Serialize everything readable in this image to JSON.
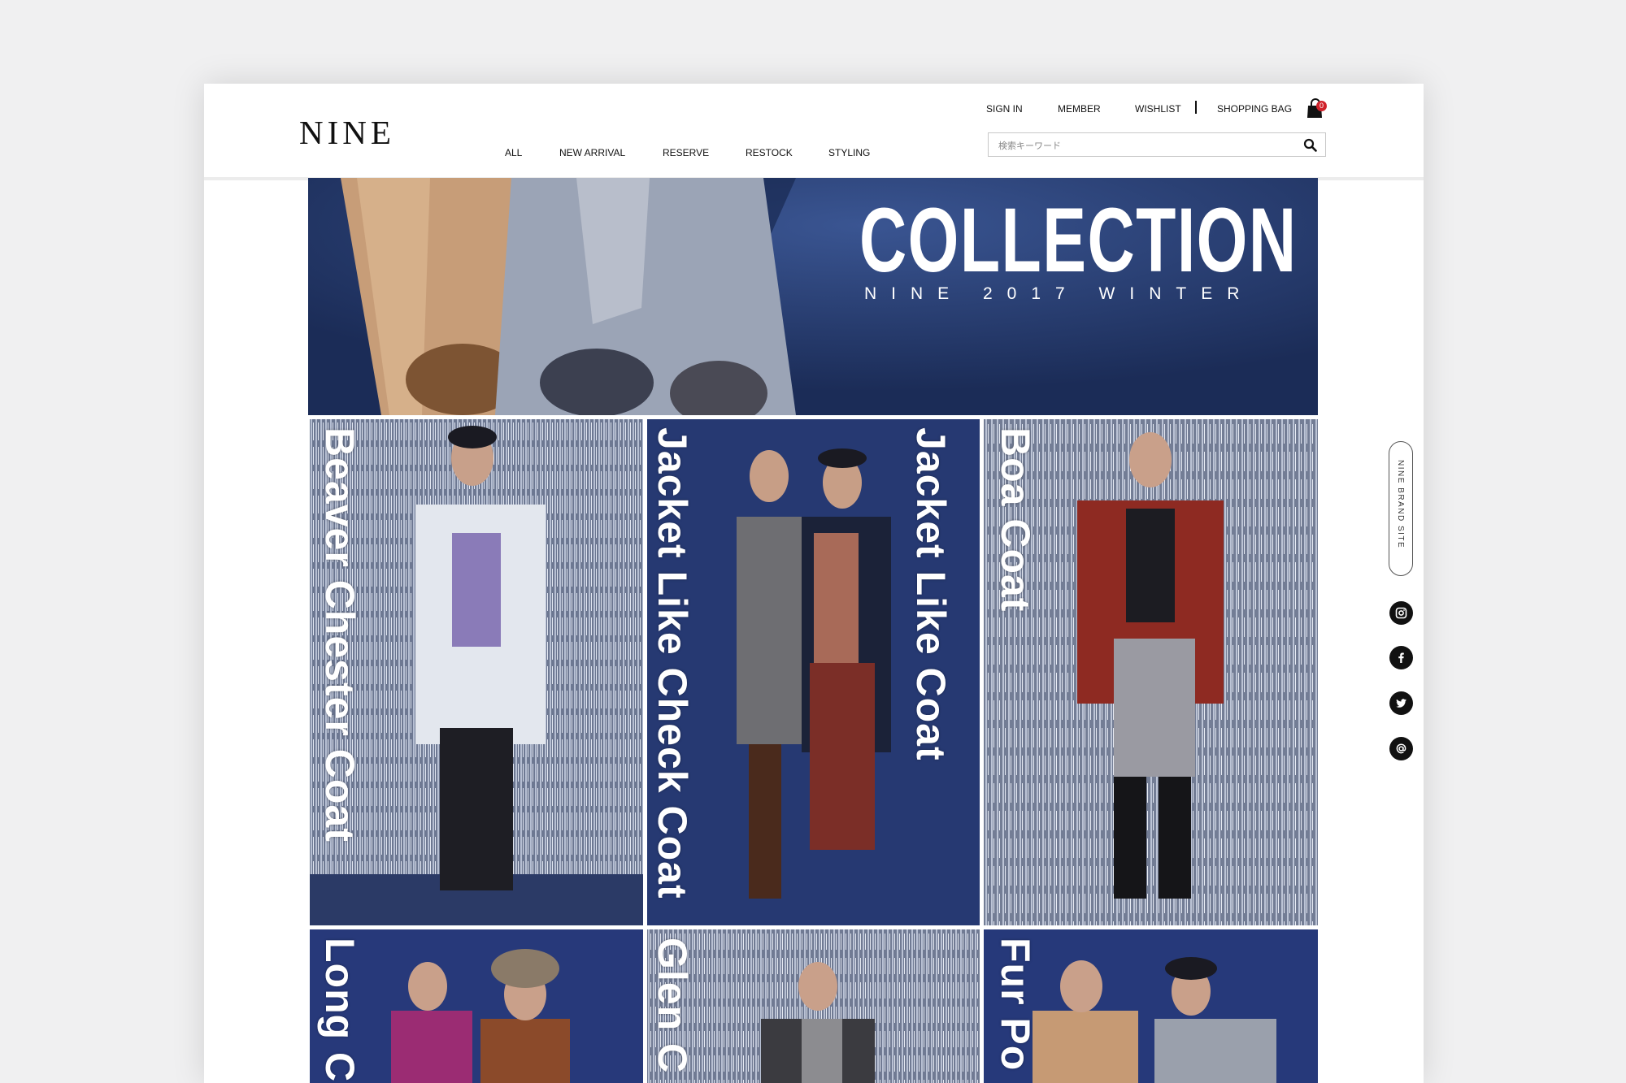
{
  "header": {
    "logo": "NINE",
    "nav": [
      "ALL",
      "NEW ARRIVAL",
      "RESERVE",
      "RESTOCK",
      "STYLING"
    ],
    "utility": {
      "sign_in": "SIGN IN",
      "member": "MEMBER",
      "wishlist": "WISHLIST",
      "shopping_bag": "SHOPPING BAG",
      "bag_count": "0"
    },
    "search": {
      "placeholder": "検索キーワード"
    }
  },
  "hero": {
    "title": "COLLECTION",
    "subtitle": "NINE 2017 WINTER"
  },
  "tiles": [
    {
      "label": "Beaver Chester Coat"
    },
    {
      "label": "Jacket Like Check Coat"
    },
    {
      "label": "Jacket Like Coat"
    },
    {
      "label": "Boa Coat"
    },
    {
      "label": "Long C"
    },
    {
      "label": "Glen C"
    },
    {
      "label": "Fur Po"
    }
  ],
  "side": {
    "brand_site": "NINE BRAND SITE",
    "icons": [
      "instagram-icon",
      "facebook-icon",
      "twitter-icon",
      "mail-icon"
    ]
  },
  "colors": {
    "navy": "#24396d",
    "sequin": "#8d97ad",
    "badge": "#d0222a"
  }
}
